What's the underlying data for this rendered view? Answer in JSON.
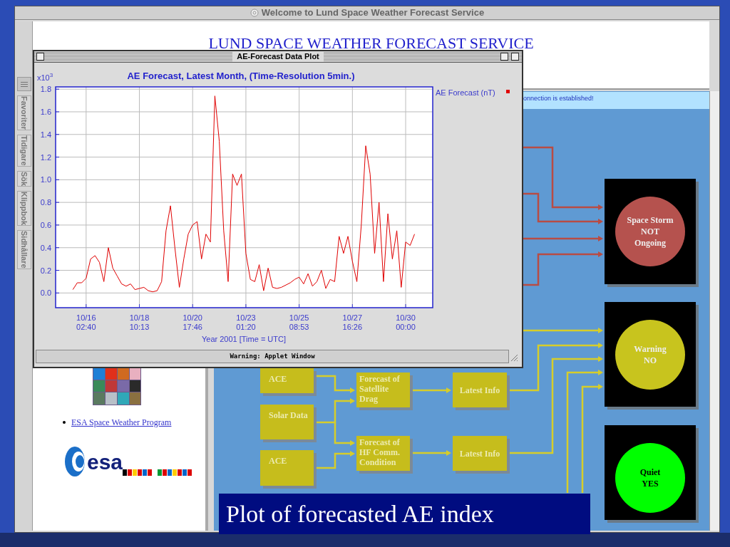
{
  "browser_window": {
    "title": "Welcome to Lund Space Weather Forecast Service",
    "sidebar_tabs": [
      "Favoriter",
      "Tidigare",
      "Sök",
      "Klippbok",
      "Sidhållare"
    ]
  },
  "page": {
    "heading": "LUND SPACE WEATHER FORECAST SERVICE",
    "status_text": "onnection is established!",
    "link": "ESA Space Weather Program",
    "logo_text": "esa"
  },
  "applet_window": {
    "title": "AE-Forecast Data Plot",
    "warning": "Warning: Applet Window",
    "chart_data": {
      "type": "line",
      "title": "AE Forecast, Latest Month, (Time-Resolution 5min.)",
      "xlabel": "Year 2001  [Time = UTC]",
      "ylabel": "x10$^{3}$",
      "categories": [
        null,
        null,
        null,
        "10/16 02:40",
        null,
        null,
        null,
        null,
        null,
        null,
        null,
        null,
        null,
        null,
        null,
        "10/18 10:13",
        null,
        null,
        null,
        null,
        null,
        null,
        null,
        null,
        null,
        null,
        null,
        "10/20 17:46",
        null,
        null,
        null,
        null,
        null,
        null,
        null,
        null,
        null,
        null,
        null,
        "10/23 01:20",
        null,
        null,
        null,
        null,
        null,
        null,
        null,
        null,
        null,
        null,
        null,
        "10/25 08:53",
        null,
        null,
        null,
        null,
        null,
        null,
        null,
        null,
        null,
        null,
        null,
        "10/27 16:26",
        null,
        null,
        null,
        null,
        null,
        null,
        null,
        null,
        null,
        null,
        null,
        "10/30 00:00",
        null,
        null
      ],
      "series": [
        {
          "name": "AE Forecast (nT)",
          "color": "#e00000",
          "values": [
            0.03,
            0.09,
            0.09,
            0.13,
            0.3,
            0.33,
            0.27,
            0.1,
            0.4,
            0.22,
            0.15,
            0.08,
            0.06,
            0.08,
            0.03,
            0.04,
            0.05,
            0.02,
            0.01,
            0.02,
            0.1,
            0.55,
            0.77,
            0.4,
            0.05,
            0.3,
            0.52,
            0.6,
            0.63,
            0.3,
            0.52,
            0.45,
            1.74,
            1.34,
            0.55,
            0.1,
            1.05,
            0.95,
            1.05,
            0.35,
            0.12,
            0.1,
            0.25,
            0.02,
            0.22,
            0.05,
            0.04,
            0.05,
            0.07,
            0.09,
            0.12,
            0.14,
            0.08,
            0.17,
            0.06,
            0.1,
            0.2,
            0.04,
            0.12,
            0.1,
            0.5,
            0.35,
            0.5,
            0.28,
            0.1,
            0.6,
            1.3,
            1.05,
            0.35,
            0.8,
            0.1,
            0.7,
            0.3,
            0.55,
            0.05,
            0.45,
            0.42,
            0.52
          ]
        }
      ],
      "ylim": [
        -0.13,
        1.82
      ],
      "grid": true,
      "yticks": [
        {
          "value": 0,
          "label": "0.0"
        },
        {
          "value": 0.2,
          "label": "0.2"
        },
        {
          "value": 0.4,
          "label": "0.4"
        },
        {
          "value": 0.6,
          "label": "0.6"
        },
        {
          "value": 0.8,
          "label": "0.8"
        },
        {
          "value": 1.0,
          "label": "1.0"
        },
        {
          "value": 1.2,
          "label": "1.2"
        },
        {
          "value": 1.4,
          "label": "1.4"
        },
        {
          "value": 1.6,
          "label": "1.6"
        },
        {
          "value": 1.8,
          "label": "1.8"
        }
      ]
    }
  },
  "diagram": {
    "sources": [
      "ACE",
      "Solar Data",
      "ACE"
    ],
    "forecasts": [
      "Forecast of Satellite Drag",
      "Forecast of HF Comm. Condition"
    ],
    "outputs": [
      "Latest Info",
      "Latest Info"
    ],
    "indicators": [
      {
        "lines": [
          "Space Storm",
          "NOT",
          "Ongoing"
        ],
        "color": "#b5524e"
      },
      {
        "lines": [
          "Warning",
          "NO"
        ],
        "color": "#c8c41e"
      },
      {
        "lines": [
          "Quiet",
          "YES"
        ],
        "color": "#00ff00"
      }
    ]
  },
  "caption": "Plot of forecasted AE index"
}
